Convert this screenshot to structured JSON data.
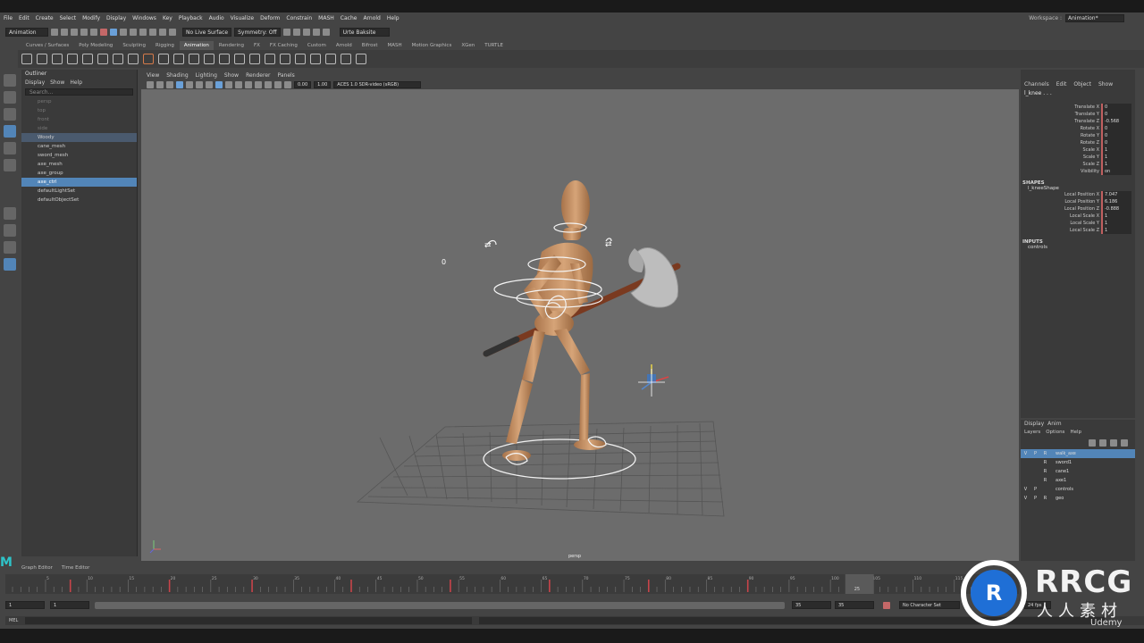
{
  "menubar": [
    "File",
    "Edit",
    "Create",
    "Select",
    "Modify",
    "Display",
    "Windows",
    "Key",
    "Playback",
    "Audio",
    "Visualize",
    "Deform",
    "Constrain",
    "MASH",
    "Cache",
    "Arnold",
    "Help"
  ],
  "workspace": {
    "label": "Workspace :",
    "value": "Animation*"
  },
  "statusline": {
    "mode": "Animation",
    "live_surface": "No Live Surface",
    "symmetry": "Symmetry: Off",
    "login": "Urte Baksite"
  },
  "shelf_tabs": [
    "Curves / Surfaces",
    "Poly Modeling",
    "Sculpting",
    "Rigging",
    "Animation",
    "Rendering",
    "FX",
    "FX Caching",
    "Custom",
    "Arnold",
    "Bifrost",
    "MASH",
    "Motion Graphics",
    "XGen",
    "TURTLE"
  ],
  "outliner": {
    "title": "Outliner",
    "menu": [
      "Display",
      "Show",
      "Help"
    ],
    "search_placeholder": "Search...",
    "items": [
      {
        "label": "persp",
        "state": "dim"
      },
      {
        "label": "top",
        "state": "dim"
      },
      {
        "label": "front",
        "state": "dim"
      },
      {
        "label": "side",
        "state": "dim"
      },
      {
        "label": "Woody",
        "state": "hl"
      },
      {
        "label": "cane_mesh",
        "state": ""
      },
      {
        "label": "sword_mesh",
        "state": ""
      },
      {
        "label": "axe_mesh",
        "state": ""
      },
      {
        "label": "axe_group",
        "state": ""
      },
      {
        "label": "axe_ctrl",
        "state": "sel"
      },
      {
        "label": "defaultLightSet",
        "state": ""
      },
      {
        "label": "defaultObjectSet",
        "state": ""
      }
    ]
  },
  "viewport": {
    "menu": [
      "View",
      "Shading",
      "Lighting",
      "Show",
      "Renderer",
      "Panels"
    ],
    "near": "0.00",
    "far": "1.00",
    "colorspace": "ACES 1.0 SDR-video (sRGB)",
    "camera_label": "persp"
  },
  "channelbox": {
    "menu": [
      "Channels",
      "Edit",
      "Object",
      "Show"
    ],
    "object": "l_knee . . .",
    "attrs": [
      {
        "n": "Translate X",
        "v": "0"
      },
      {
        "n": "Translate Y",
        "v": "0"
      },
      {
        "n": "Translate Z",
        "v": "-0.568"
      },
      {
        "n": "Rotate X",
        "v": "0"
      },
      {
        "n": "Rotate Y",
        "v": "0"
      },
      {
        "n": "Rotate Z",
        "v": "0"
      },
      {
        "n": "Scale X",
        "v": "1"
      },
      {
        "n": "Scale Y",
        "v": "1"
      },
      {
        "n": "Scale Z",
        "v": "1"
      },
      {
        "n": "Visibility",
        "v": "on"
      }
    ],
    "shapes_title": "SHAPES",
    "shape_name": "l_kneeShape",
    "shape_attrs": [
      {
        "n": "Local Position X",
        "v": "7.047"
      },
      {
        "n": "Local Position Y",
        "v": "6.186"
      },
      {
        "n": "Local Position Z",
        "v": "-0.888"
      },
      {
        "n": "Local Scale X",
        "v": "1"
      },
      {
        "n": "Local Scale Y",
        "v": "1"
      },
      {
        "n": "Local Scale Z",
        "v": "1"
      }
    ],
    "inputs_title": "INPUTS",
    "input_name": "controls"
  },
  "layers": {
    "tabs": [
      "Display",
      "Anim"
    ],
    "menu": [
      "Layers",
      "Options",
      "Help"
    ],
    "rows": [
      {
        "v": "V",
        "p": "P",
        "r": "R",
        "name": "walk_axe",
        "sel": true
      },
      {
        "v": "",
        "p": "",
        "r": "R",
        "name": "sword1",
        "sel": false
      },
      {
        "v": "",
        "p": "",
        "r": "R",
        "name": "cane1",
        "sel": false
      },
      {
        "v": "",
        "p": "",
        "r": "R",
        "name": "axe1",
        "sel": false
      },
      {
        "v": "V",
        "p": "P",
        "r": "",
        "name": "controls",
        "sel": false
      },
      {
        "v": "V",
        "p": "P",
        "r": "R",
        "name": "geo",
        "sel": false
      }
    ]
  },
  "editor_tabs": [
    "Graph Editor",
    "Time Editor"
  ],
  "timeline": {
    "start": 1,
    "end": 35,
    "current": 25,
    "ticks": [
      "5",
      "10",
      "15",
      "20",
      "25",
      "30",
      "35",
      "40",
      "45",
      "50",
      "55",
      "60",
      "65",
      "70",
      "75",
      "80",
      "85",
      "90",
      "95",
      "100",
      "105",
      "110",
      "115",
      "120"
    ]
  },
  "range": {
    "start": "1",
    "inner_start": "1",
    "inner_end": "35",
    "end": "35",
    "anim_end": "35",
    "character_set": "No Character Set",
    "fps": "24 fps"
  },
  "cmdline": {
    "lang": "MEL"
  },
  "watermark": {
    "text": "RRCG",
    "sub": "人人素材",
    "udemy": "Udemy"
  }
}
